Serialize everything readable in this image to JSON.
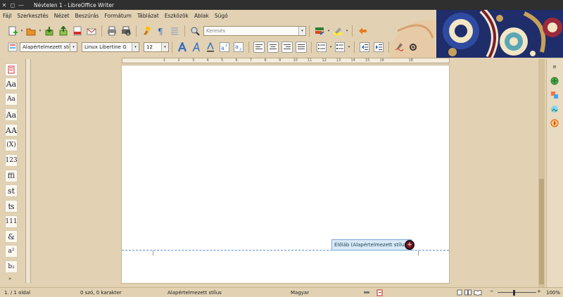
{
  "window": {
    "title": "Névtelen 1 - LibreOffice Writer",
    "buttons": {
      "close": "✕",
      "restore": "◻",
      "minimize": "—"
    }
  },
  "menu": [
    "Fájl",
    "Szerkesztés",
    "Nézet",
    "Beszúrás",
    "Formátum",
    "Táblázat",
    "Eszközök",
    "Ablak",
    "Súgó"
  ],
  "toolbar": {
    "search_placeholder": "Keresés"
  },
  "format_toolbar": {
    "paragraph_style": "Alapértelmezett stí",
    "font_name": "Linux Libertine G",
    "font_size": "12"
  },
  "fontwork_sidebar": [
    "Aa",
    "Aa",
    "Aa",
    "AA",
    "(X)",
    "123",
    "ffi",
    "st",
    "ʦ",
    "111",
    "&",
    "a²",
    "b₂"
  ],
  "ruler": {
    "marks": [
      "1",
      "2",
      "3",
      "4",
      "5",
      "6",
      "7",
      "8",
      "9",
      "10",
      "11",
      "12",
      "13",
      "14",
      "15",
      "16",
      "18"
    ]
  },
  "document": {
    "footer_label": "Élőláb (Alapértelmezett stílus)",
    "footer_add": "+"
  },
  "status": {
    "page": "1. / 1 oldal",
    "words": "0 szó, 0 karakter",
    "style": "Alapértelmezett stílus",
    "language": "Magyar",
    "zoom": "100%",
    "zoom_minus": "−",
    "zoom_plus": "+"
  },
  "colors": {
    "background": "#e2d2b3",
    "accent": "#5b8fc9",
    "footer_add": "#7a1420"
  }
}
